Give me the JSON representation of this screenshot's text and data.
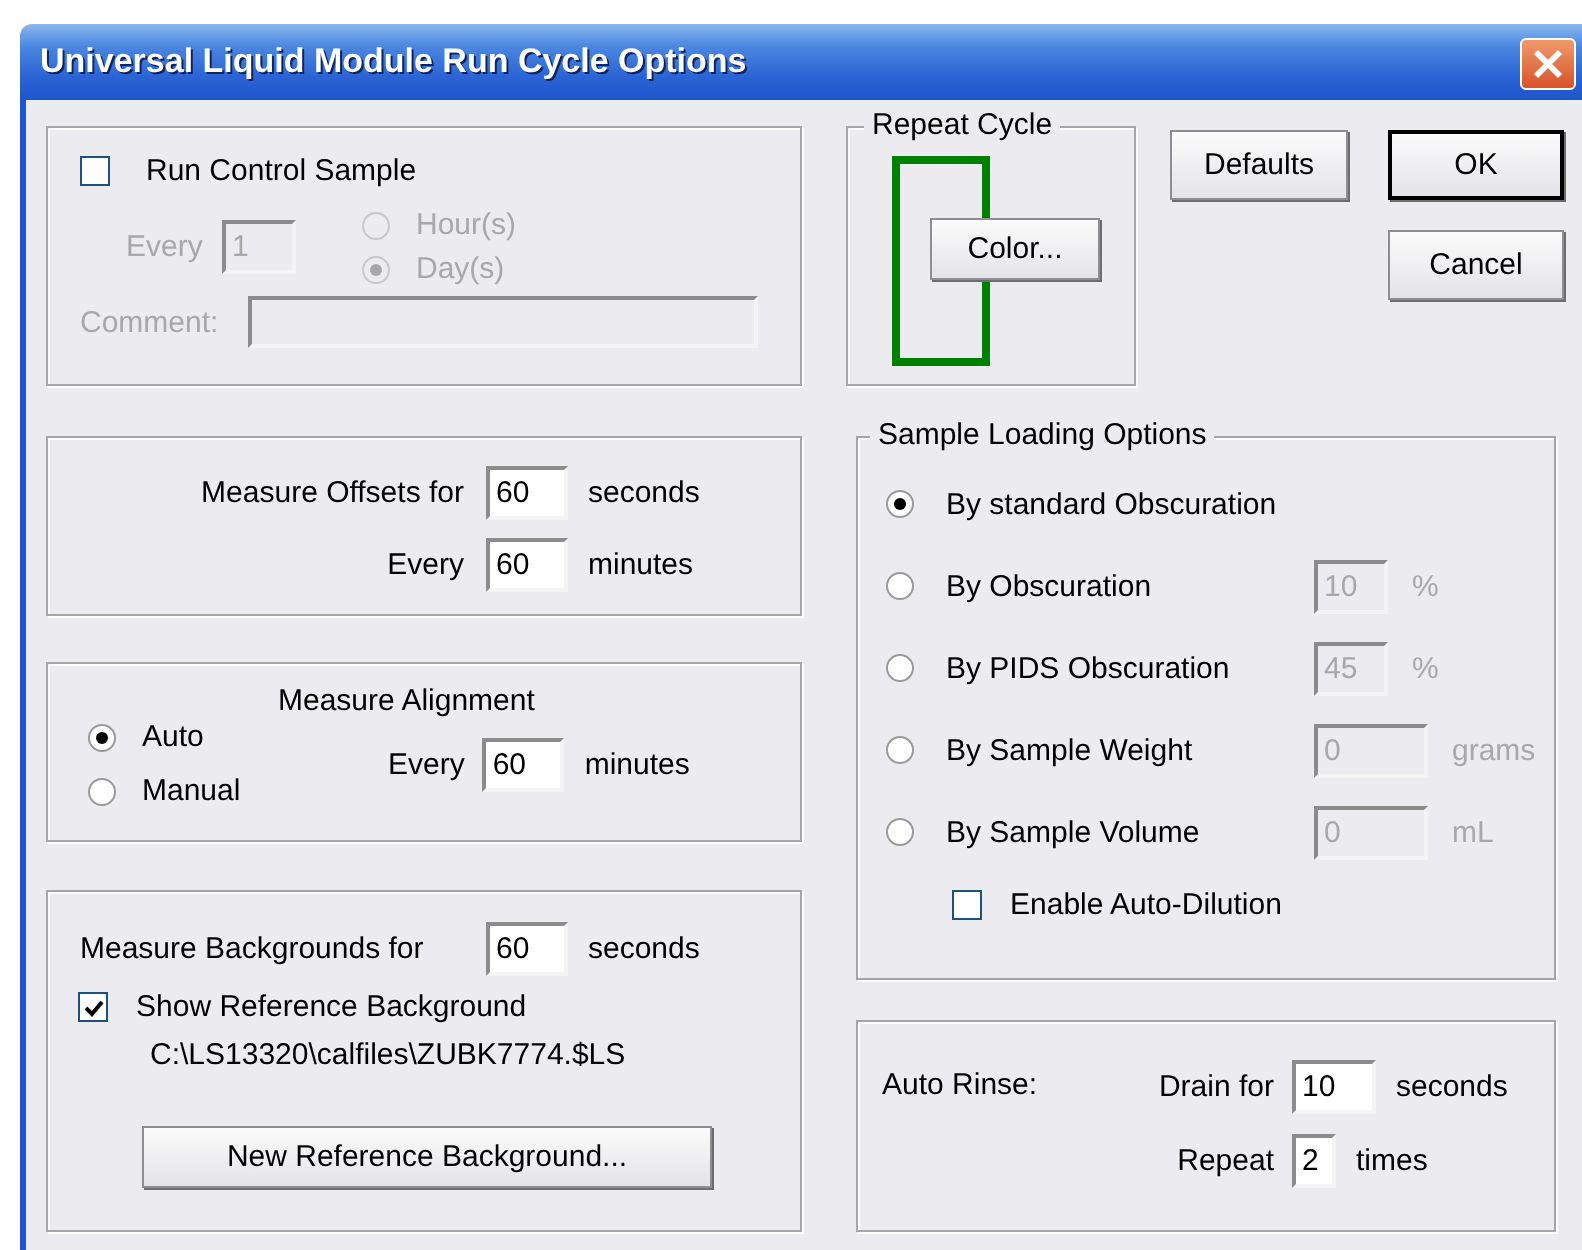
{
  "window": {
    "title": "Universal Liquid Module Run Cycle Options"
  },
  "control_sample": {
    "label": "Run Control Sample",
    "checked": false,
    "disabled": true,
    "every_label": "Every",
    "every_value": "1",
    "units": [
      {
        "label": "Hour(s)",
        "selected": false
      },
      {
        "label": "Day(s)",
        "selected": true
      }
    ],
    "comment_label": "Comment:"
  },
  "offsets": {
    "rows": [
      {
        "label": "Measure Offsets for",
        "value": "60",
        "unit": "seconds"
      },
      {
        "label": "Every",
        "value": "60",
        "unit": "minutes"
      }
    ]
  },
  "alignment": {
    "title": "Measure Alignment",
    "modes": [
      {
        "label": "Auto",
        "selected": true
      },
      {
        "label": "Manual",
        "selected": false
      }
    ],
    "every_label": "Every",
    "value": "60",
    "unit": "minutes"
  },
  "backgrounds": {
    "label": "Measure Backgrounds for",
    "value": "60",
    "unit": "seconds",
    "show_reference": {
      "label": "Show Reference Background",
      "checked": true
    },
    "path": "C:\\LS13320\\calfiles\\ZUBK7774.$LS",
    "button": "New Reference Background..."
  },
  "repeat_cycle": {
    "title": "Repeat Cycle",
    "color": "#008000",
    "button": "Color..."
  },
  "buttons": [
    {
      "label": "Defaults",
      "default": false
    },
    {
      "label": "OK",
      "default": true
    },
    {
      "label": "Cancel",
      "default": false
    }
  ],
  "sample_loading": {
    "title": "Sample Loading Options",
    "options": [
      {
        "label": "By standard Obscuration",
        "selected": true
      },
      {
        "label": "By Obscuration",
        "selected": false,
        "value": "10",
        "unit": "%",
        "disabled": true
      },
      {
        "label": "By PIDS Obscuration",
        "selected": false,
        "value": "45",
        "unit": "%",
        "disabled": true
      },
      {
        "label": "By Sample Weight",
        "selected": false,
        "value": "0",
        "unit": "grams",
        "disabled": true
      },
      {
        "label": "By Sample Volume",
        "selected": false,
        "value": "0",
        "unit": "mL",
        "disabled": true
      }
    ],
    "auto_dilution": {
      "label": "Enable Auto-Dilution",
      "checked": false
    }
  },
  "auto_rinse": {
    "label": "Auto Rinse:",
    "rows": [
      {
        "label": "Drain for",
        "value": "10",
        "unit": "seconds"
      },
      {
        "label": "Repeat",
        "value": "2",
        "unit": "times"
      }
    ]
  }
}
